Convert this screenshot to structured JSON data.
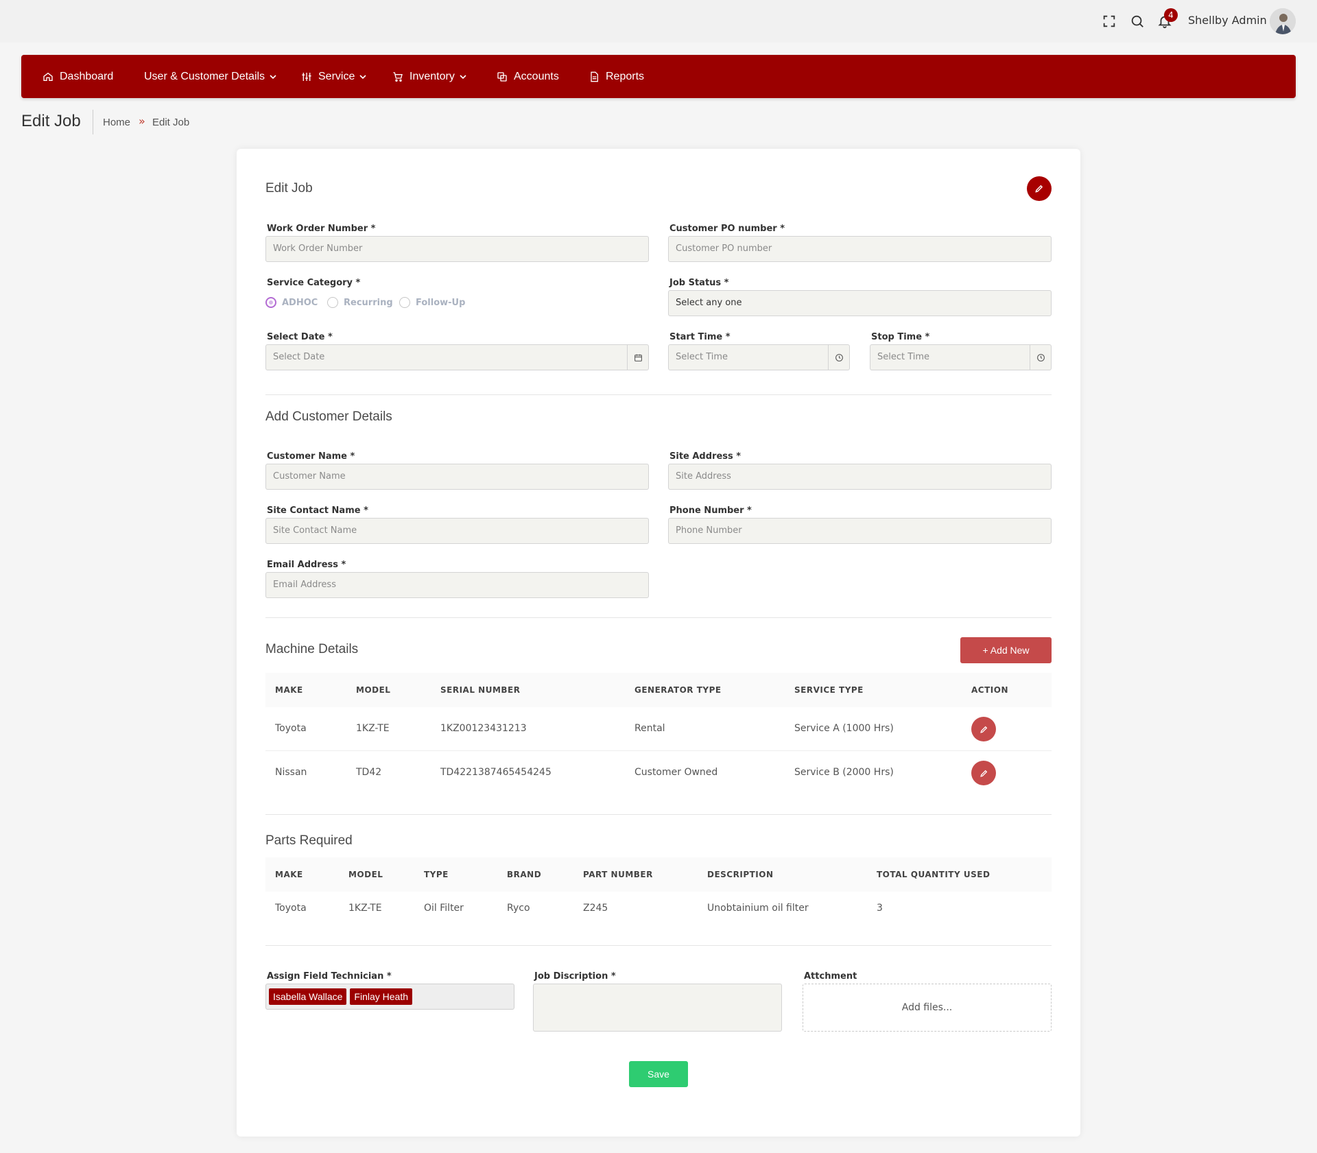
{
  "topbar": {
    "user_name": "Shellby Admin",
    "notification_count": "4",
    "icons": [
      "fullscreen-icon",
      "search-icon",
      "bell-icon"
    ]
  },
  "nav": {
    "items": [
      {
        "label": "Dashboard",
        "icon": "home-icon",
        "has_dropdown": false
      },
      {
        "label": "User & Customer Details",
        "icon": "",
        "has_dropdown": true
      },
      {
        "label": "Service",
        "icon": "sliders-icon",
        "has_dropdown": true
      },
      {
        "label": "Inventory",
        "icon": "cart-icon",
        "has_dropdown": true
      },
      {
        "label": "Accounts",
        "icon": "copy-icon",
        "has_dropdown": false
      },
      {
        "label": "Reports",
        "icon": "document-icon",
        "has_dropdown": false
      }
    ],
    "color": "#9b0000"
  },
  "page": {
    "title": "Edit Job",
    "breadcrumb": [
      "Home",
      "Edit Job"
    ],
    "breadcrumb_sep": "»"
  },
  "job": {
    "heading": "Edit Job",
    "work_order": {
      "label": "Work Order Number *",
      "placeholder": "Work Order Number"
    },
    "customer_po": {
      "label": "Customer PO number *",
      "placeholder": "Customer PO number"
    },
    "service_category": {
      "label": "Service Category *",
      "options": [
        "ADHOC",
        "Recurring",
        "Follow-Up"
      ],
      "selected": "ADHOC"
    },
    "job_status": {
      "label": "Job Status *",
      "value": "Select any one"
    },
    "select_date": {
      "label": "Select Date *",
      "placeholder": "Select Date"
    },
    "start_time": {
      "label": "Start Time *",
      "placeholder": "Select Time"
    },
    "stop_time": {
      "label": "Stop Time *",
      "placeholder": "Select Time"
    }
  },
  "customer": {
    "heading": "Add Customer Details",
    "customer_name": {
      "label": "Customer Name *",
      "placeholder": "Customer Name"
    },
    "site_address": {
      "label": "Site Address *",
      "placeholder": "Site Address"
    },
    "site_contact": {
      "label": "Site Contact Name *",
      "placeholder": "Site Contact Name"
    },
    "phone": {
      "label": "Phone Number *",
      "placeholder": "Phone Number"
    },
    "email": {
      "label": "Email Address *",
      "placeholder": "Email Address"
    }
  },
  "machines": {
    "heading": "Machine Details",
    "add_label": "+ Add New",
    "columns": [
      "MAKE",
      "MODEL",
      "SERIAL NUMBER",
      "GENERATOR TYPE",
      "SERVICE TYPE",
      "ACTION"
    ],
    "rows": [
      {
        "make": "Toyota",
        "model": "1KZ-TE",
        "serial": "1KZ00123431213",
        "generator": "Rental",
        "service": "Service A (1000 Hrs)"
      },
      {
        "make": "Nissan",
        "model": "TD42",
        "serial": "TD4221387465454245",
        "generator": "Customer Owned",
        "service": "Service B (2000 Hrs)"
      }
    ]
  },
  "parts": {
    "heading": "Parts Required",
    "columns": [
      "MAKE",
      "MODEL",
      "TYPE",
      "BRAND",
      "PART NUMBER",
      "DESCRIPTION",
      "TOTAL QUANTITY USED"
    ],
    "rows": [
      {
        "make": "Toyota",
        "model": "1KZ-TE",
        "type": "Oil Filter",
        "brand": "Ryco",
        "part": "Z245",
        "description": "Unobtainium oil filter",
        "qty": "3"
      }
    ]
  },
  "bottom": {
    "technician_label": "Assign Field Technician *",
    "technicians": [
      "Isabella Wallace",
      "Finlay Heath"
    ],
    "description_label": "Job Discription *",
    "attachment_label": "Attchment",
    "dropzone_text": "Add files...",
    "save_label": "Save"
  }
}
